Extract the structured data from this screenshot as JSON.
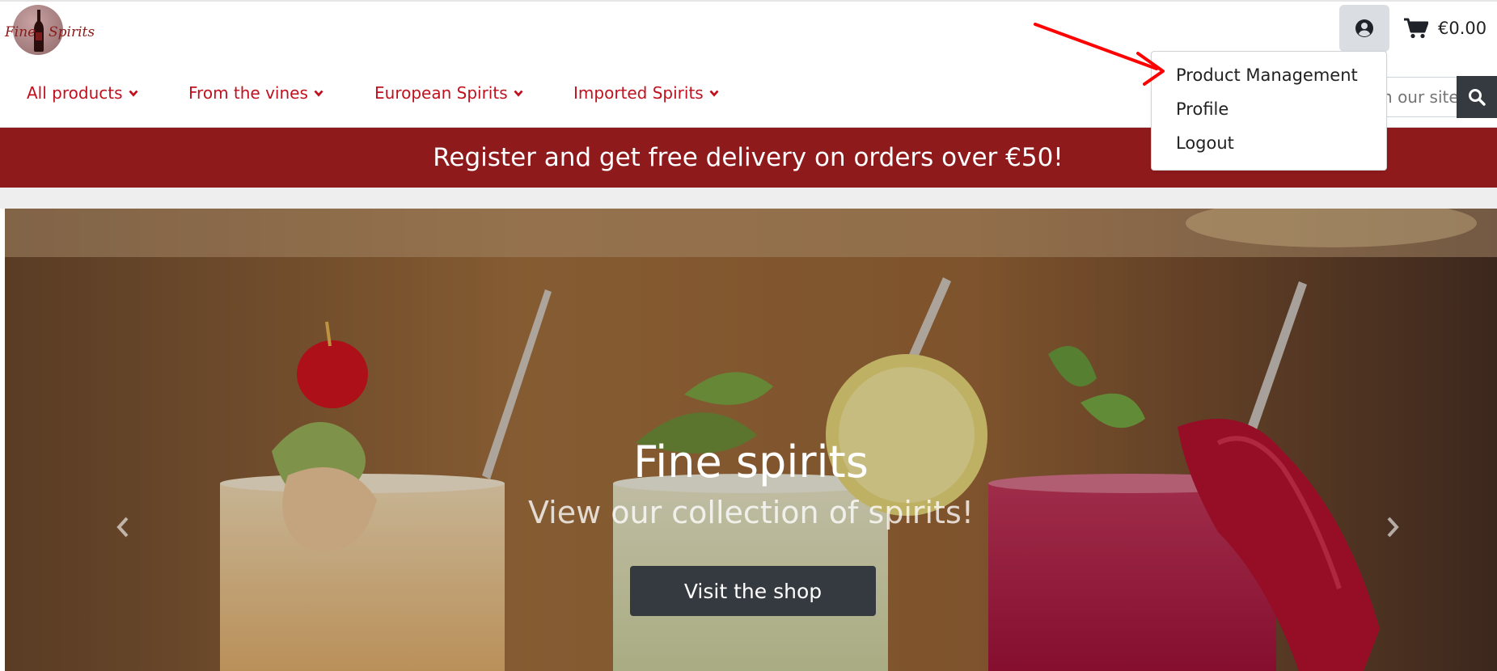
{
  "brand": {
    "logo_word_1": "Fine",
    "logo_word_2": "Spirits",
    "color": "#8b1a1a"
  },
  "header": {
    "account_icon": "user-circle-icon",
    "cart_icon": "shopping-cart-icon",
    "cart_total": "€0.00",
    "search": {
      "placeholder": "Search our site",
      "visible_fragment": "st",
      "button_icon": "search-icon"
    }
  },
  "nav": {
    "items": [
      {
        "label": "All products"
      },
      {
        "label": "From the vines"
      },
      {
        "label": "European Spirits"
      },
      {
        "label": "Imported Spirits"
      }
    ],
    "color": "#c0111f"
  },
  "account_dropdown": {
    "items": [
      {
        "label": "Product Management"
      },
      {
        "label": "Profile"
      },
      {
        "label": "Logout"
      }
    ]
  },
  "banner": {
    "text": "Register and get free delivery on orders over €50!",
    "color": "#8e1a1c"
  },
  "hero": {
    "title": "Fine spirits",
    "subtitle": "View our collection of spirits!",
    "cta_label": "Visit the shop",
    "prev_icon": "chevron-left-icon",
    "next_icon": "chevron-right-icon"
  },
  "annotation": {
    "arrow_color": "#ff0000"
  }
}
